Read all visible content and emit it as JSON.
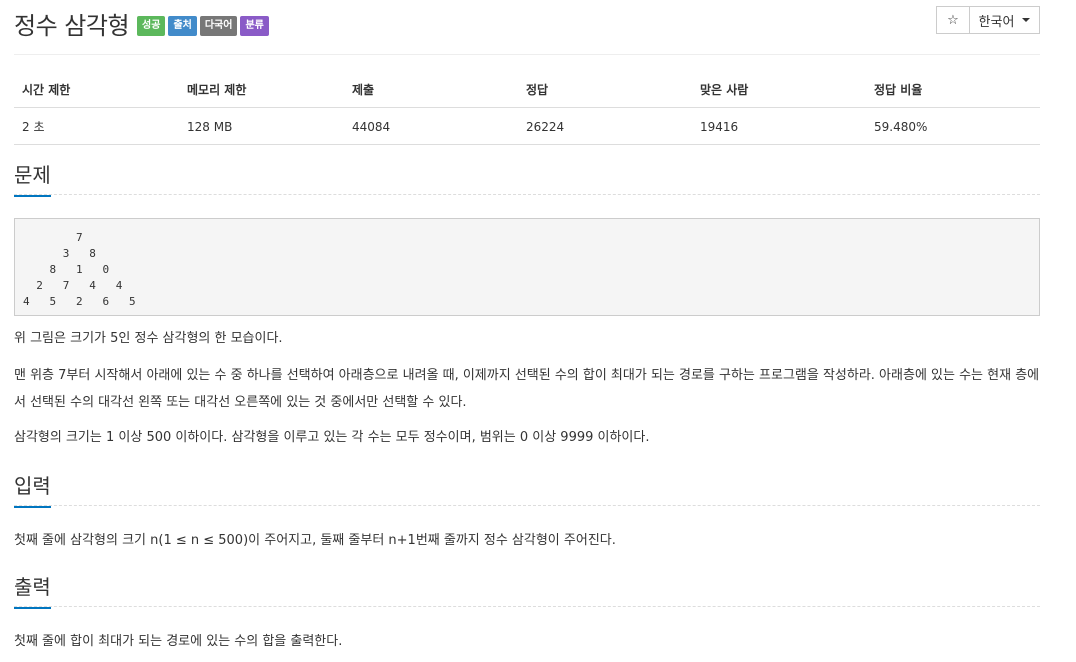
{
  "problem": {
    "title": "정수 삼각형",
    "labels": [
      {
        "text": "성공",
        "color": "#5cb85c"
      },
      {
        "text": "출처",
        "color": "#428bca"
      },
      {
        "text": "다국어",
        "color": "#777777"
      },
      {
        "text": "분류",
        "color": "#8a5bc7"
      }
    ]
  },
  "toolbar": {
    "star_icon": "☆",
    "language": "한국어"
  },
  "info": {
    "headers": [
      "시간 제한",
      "메모리 제한",
      "제출",
      "정답",
      "맞은 사람",
      "정답 비율"
    ],
    "values": [
      "2 초",
      "128 MB",
      "44084",
      "26224",
      "19416",
      "59.480%"
    ]
  },
  "sections": {
    "problem": {
      "title": "문제",
      "triangle": "        7\n      3   8\n    8   1   0\n  2   7   4   4\n4   5   2   6   5",
      "p1": "위 그림은 크기가 5인 정수 삼각형의 한 모습이다.",
      "p2": "맨 위층 7부터 시작해서 아래에 있는 수 중 하나를 선택하여 아래층으로 내려올 때, 이제까지 선택된 수의 합이 최대가 되는 경로를 구하는 프로그램을 작성하라. 아래층에 있는 수는 현재 층에서 선택된 수의 대각선 왼쪽 또는 대각선 오른쪽에 있는 것 중에서만 선택할 수 있다.",
      "p3": "삼각형의 크기는 1 이상 500 이하이다. 삼각형을 이루고 있는 각 수는 모두 정수이며, 범위는 0 이상 9999 이하이다."
    },
    "input": {
      "title": "입력",
      "text": "첫째 줄에 삼각형의 크기 n(1 ≤ n ≤ 500)이 주어지고, 둘째 줄부터 n+1번째 줄까지 정수 삼각형이 주어진다."
    },
    "output": {
      "title": "출력",
      "text": "첫째 줄에 합이 최대가 되는 경로에 있는 수의 합을 출력한다."
    }
  }
}
